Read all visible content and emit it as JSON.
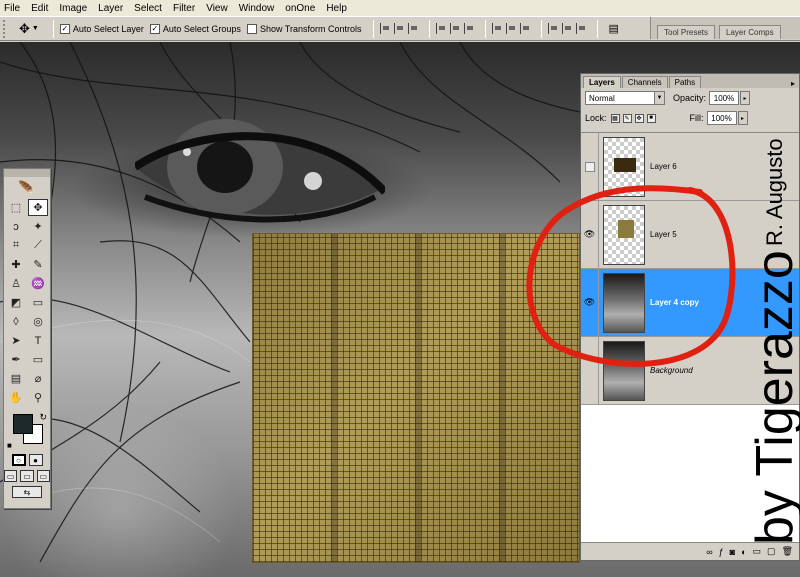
{
  "menu": [
    "File",
    "Edit",
    "Image",
    "Layer",
    "Select",
    "Filter",
    "View",
    "Window",
    "onOne",
    "Help"
  ],
  "options": {
    "auto_select_layer": "Auto Select Layer",
    "auto_select_groups": "Auto Select Groups",
    "show_transform_controls": "Show Transform Controls",
    "auto_select_layer_checked": true,
    "auto_select_groups_checked": true,
    "show_transform_controls_checked": false
  },
  "palette_well": [
    "Tool Presets",
    "Layer Comps"
  ],
  "layers_panel": {
    "tabs": [
      "Layers",
      "Channels",
      "Paths"
    ],
    "blend_mode": "Normal",
    "opacity_label": "Opacity:",
    "opacity_value": "100%",
    "lock_label": "Lock:",
    "fill_label": "Fill:",
    "fill_value": "100%",
    "layers": [
      {
        "name": "Layer 6",
        "visible": false,
        "active": false
      },
      {
        "name": "Layer 5",
        "visible": true,
        "active": false
      },
      {
        "name": "Layer 4 copy",
        "visible": true,
        "active": true
      },
      {
        "name": "Background",
        "visible": false,
        "active": false
      }
    ]
  },
  "watermark": {
    "main": "by Tigerazzo",
    "secondary": "R. Augusto"
  },
  "colors": {
    "highlight": "#3399ff",
    "annotation": "#e02010",
    "foreground": "#1e2a2a",
    "background": "#ffffff"
  }
}
